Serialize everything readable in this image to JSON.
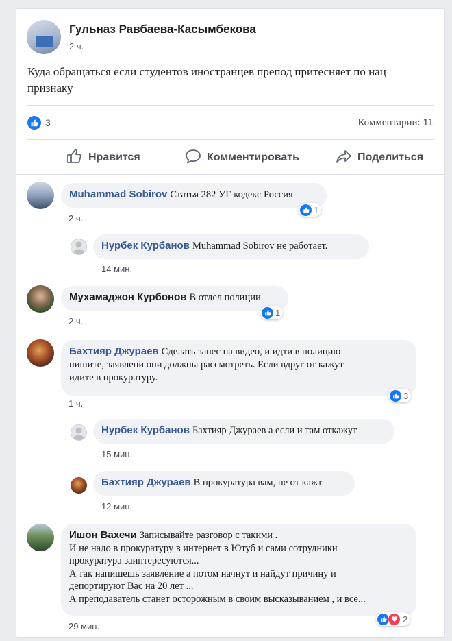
{
  "post": {
    "author": "Гульназ Равбаева-Касымбекова",
    "time": "2 ч.",
    "text_line1": "Куда обращаться если студентов иностранцев препод притесняет по нац",
    "text_line2": "признаку",
    "like_count": "3",
    "comments_label": "Комментарии:",
    "comments_count": "11"
  },
  "actions": {
    "like": "Нравится",
    "comment": "Комментировать",
    "share": "Поделиться"
  },
  "comments": [
    {
      "name": "Muhammad Sobirov",
      "text": "Статья 282 УГ кодекс Россия",
      "time": "2 ч.",
      "reactions": "1"
    },
    {
      "name": "Нурбек Курбанов",
      "text": "Muhammad Sobirov не работает.",
      "time": "14 мин."
    },
    {
      "name": "Мухамаджон Курбонов",
      "text": "В отдел полиции",
      "time": "2 ч.",
      "reactions": "1"
    },
    {
      "name": "Бахтияр Джураев",
      "text_line1": "Сделать запес на видео, и идти в полицию",
      "text_line2": "пишите, заявлени они должны рассмотреть. Если вдруг от кажут",
      "text_line3": "идите в прокуратуру.",
      "time": "1 ч.",
      "reactions": "3"
    },
    {
      "name": "Нурбек Курбанов",
      "text": "Бахтияр Джураев а если и там откажут",
      "time": "15 мин."
    },
    {
      "name": "Бахтияр Джураев",
      "text": "В прокуратура вам, не от кажт",
      "time": "12 мин."
    },
    {
      "name": "Ишон Вахечи",
      "text_line1": "Записывайте разговор с такими .",
      "text_line2": "И не надо в прокуратуру в интернет в Ютуб и сами сотрудники",
      "text_line3": "прокуратура заинтересуются...",
      "text_line4": "А так напишешь заявление а потом начнут и найдут причину и",
      "text_line5": "депортируют Вас на 20 лет ...",
      "text_line6": "А преподаватель станет осторожным в своим высказыванием , и все...",
      "time": "29 мин.",
      "reactions": "2"
    }
  ],
  "colors": {
    "brand": "#1877f2",
    "link": "#385898",
    "love": "#f33e58"
  }
}
